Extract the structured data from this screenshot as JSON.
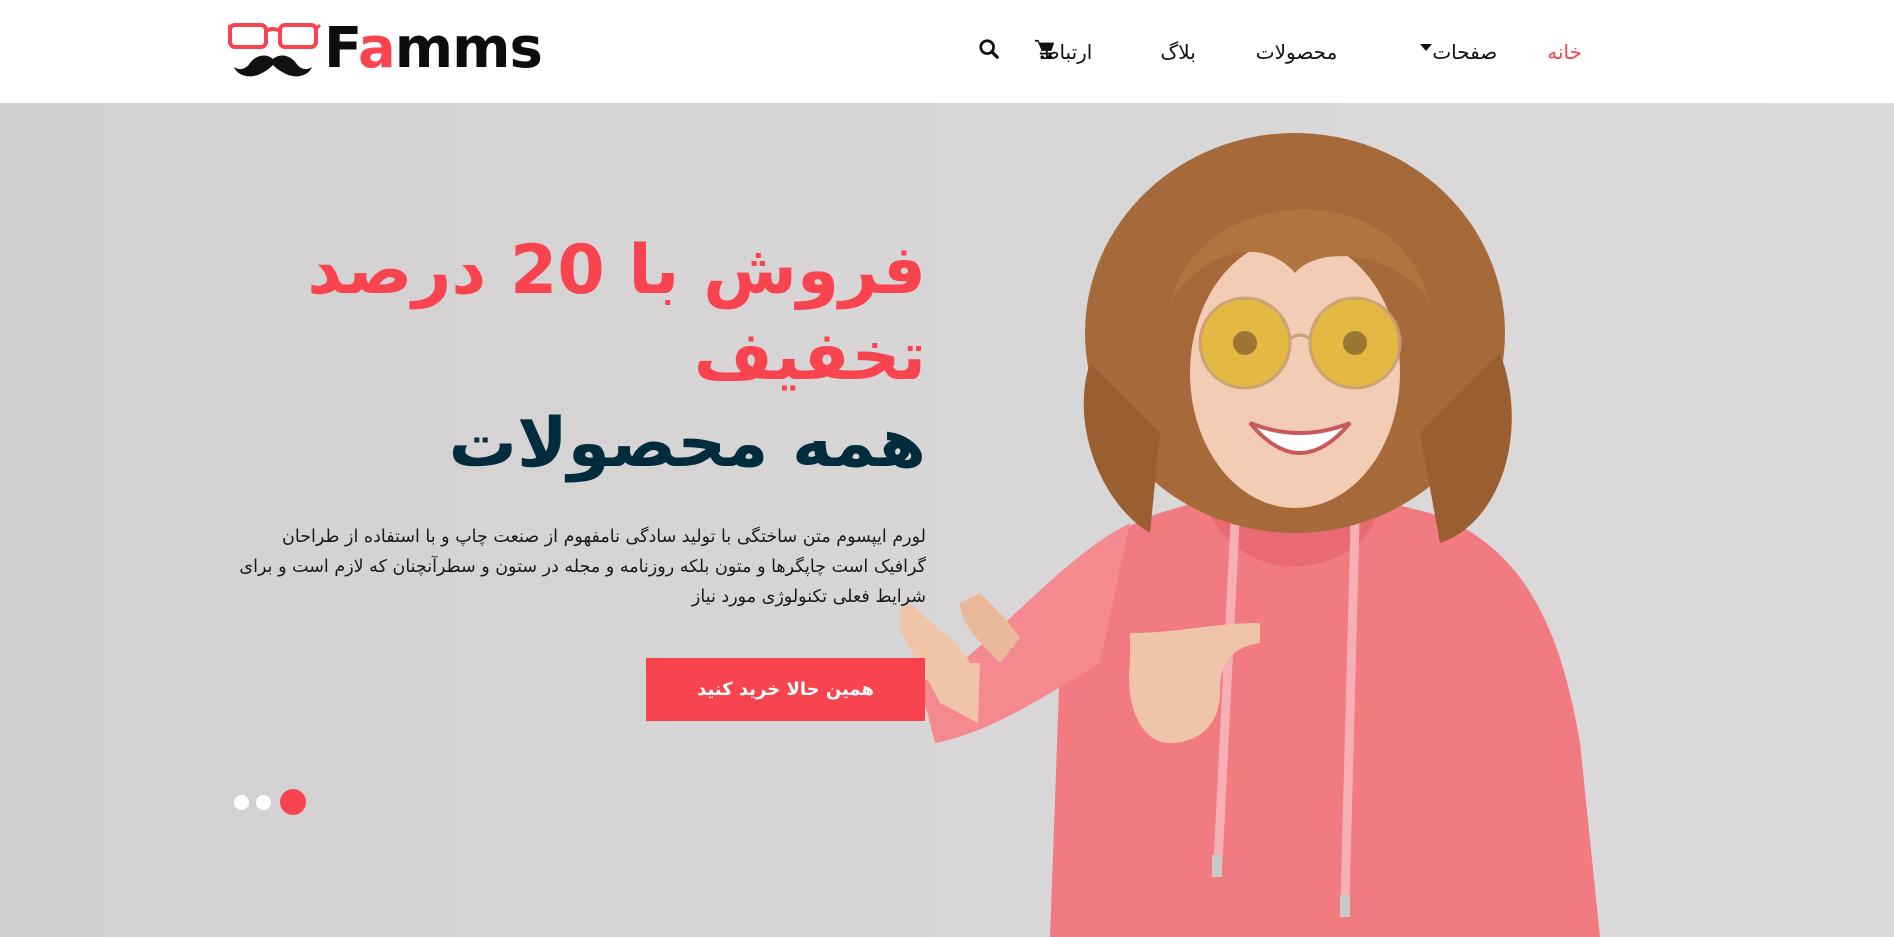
{
  "brand": {
    "name_prefix": "F",
    "name_accent": "a",
    "name_suffix": "mms",
    "logo_icon": "glasses-mustache-icon"
  },
  "nav": {
    "items": [
      {
        "label": "خانه",
        "active": true
      },
      {
        "label": "صفحات",
        "has_dropdown": true
      },
      {
        "label": "محصولات"
      },
      {
        "label": "بلاگ"
      },
      {
        "label": "ارتباط"
      }
    ],
    "icons": [
      "cart-icon",
      "search-icon"
    ]
  },
  "hero": {
    "title_line_1": "فروش با 20 درصد تخفیف",
    "title_line_2": "همه محصولات",
    "description": "لورم ایپسوم متن ساختگی با تولید سادگی نامفهوم از صنعت چاپ و با استفاده از طراحان گرافیک است چاپگرها و متون بلکه روزنامه و مجله در ستون و سطرآنچنان که لازم است و برای شرایط فعلی تکنولوژی مورد نیاز",
    "cta_label": "همین حالا خرید کنید",
    "slides_count": 3,
    "active_slide": 1
  },
  "colors": {
    "accent": "#f7444e",
    "dark": "#002c3e",
    "hero_bg": "#d6d4d4"
  }
}
